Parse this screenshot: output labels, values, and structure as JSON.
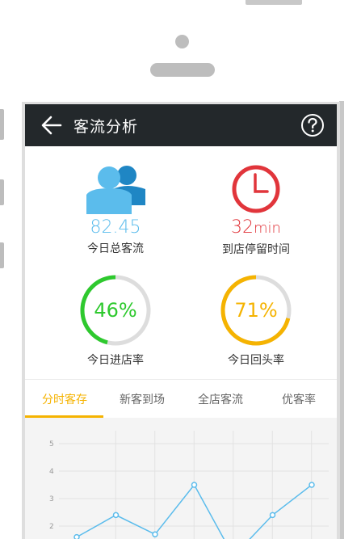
{
  "header": {
    "title": "客流分析",
    "back_icon": "arrow-left-icon",
    "help_icon": "question-circle-icon"
  },
  "stats": {
    "traffic": {
      "value": "82.45",
      "label": "今日总客流",
      "icon": "users-icon",
      "color": "#5bbcec"
    },
    "dwell": {
      "value": "32",
      "unit": "min",
      "label": "到店停留时间",
      "icon": "clock-icon",
      "color": "#e1353b"
    },
    "entry_rate": {
      "value": "46%",
      "fraction": 0.46,
      "label": "今日进店率",
      "color": "#2ec92e",
      "track": "#dddddd"
    },
    "return_rate": {
      "value": "71%",
      "fraction": 0.71,
      "label": "今日回头率",
      "color": "#f5b301",
      "track": "#dddddd"
    }
  },
  "tabs": [
    {
      "label": "分时客存",
      "active": true
    },
    {
      "label": "新客到场",
      "active": false
    },
    {
      "label": "全店客流",
      "active": false
    },
    {
      "label": "优客率",
      "active": false
    }
  ],
  "colors": {
    "accent": "#f5b301",
    "topbar": "#23282b",
    "line": "#5bbcec"
  },
  "chart_data": {
    "type": "line",
    "y_ticks": [
      "5",
      "4",
      "3",
      "2"
    ],
    "ylim": [
      1,
      5
    ],
    "x": [
      1,
      2,
      3,
      4,
      5,
      6,
      7
    ],
    "values": [
      1.6,
      2.4,
      1.7,
      3.5,
      0.9,
      2.4,
      3.5
    ],
    "grid": true
  }
}
